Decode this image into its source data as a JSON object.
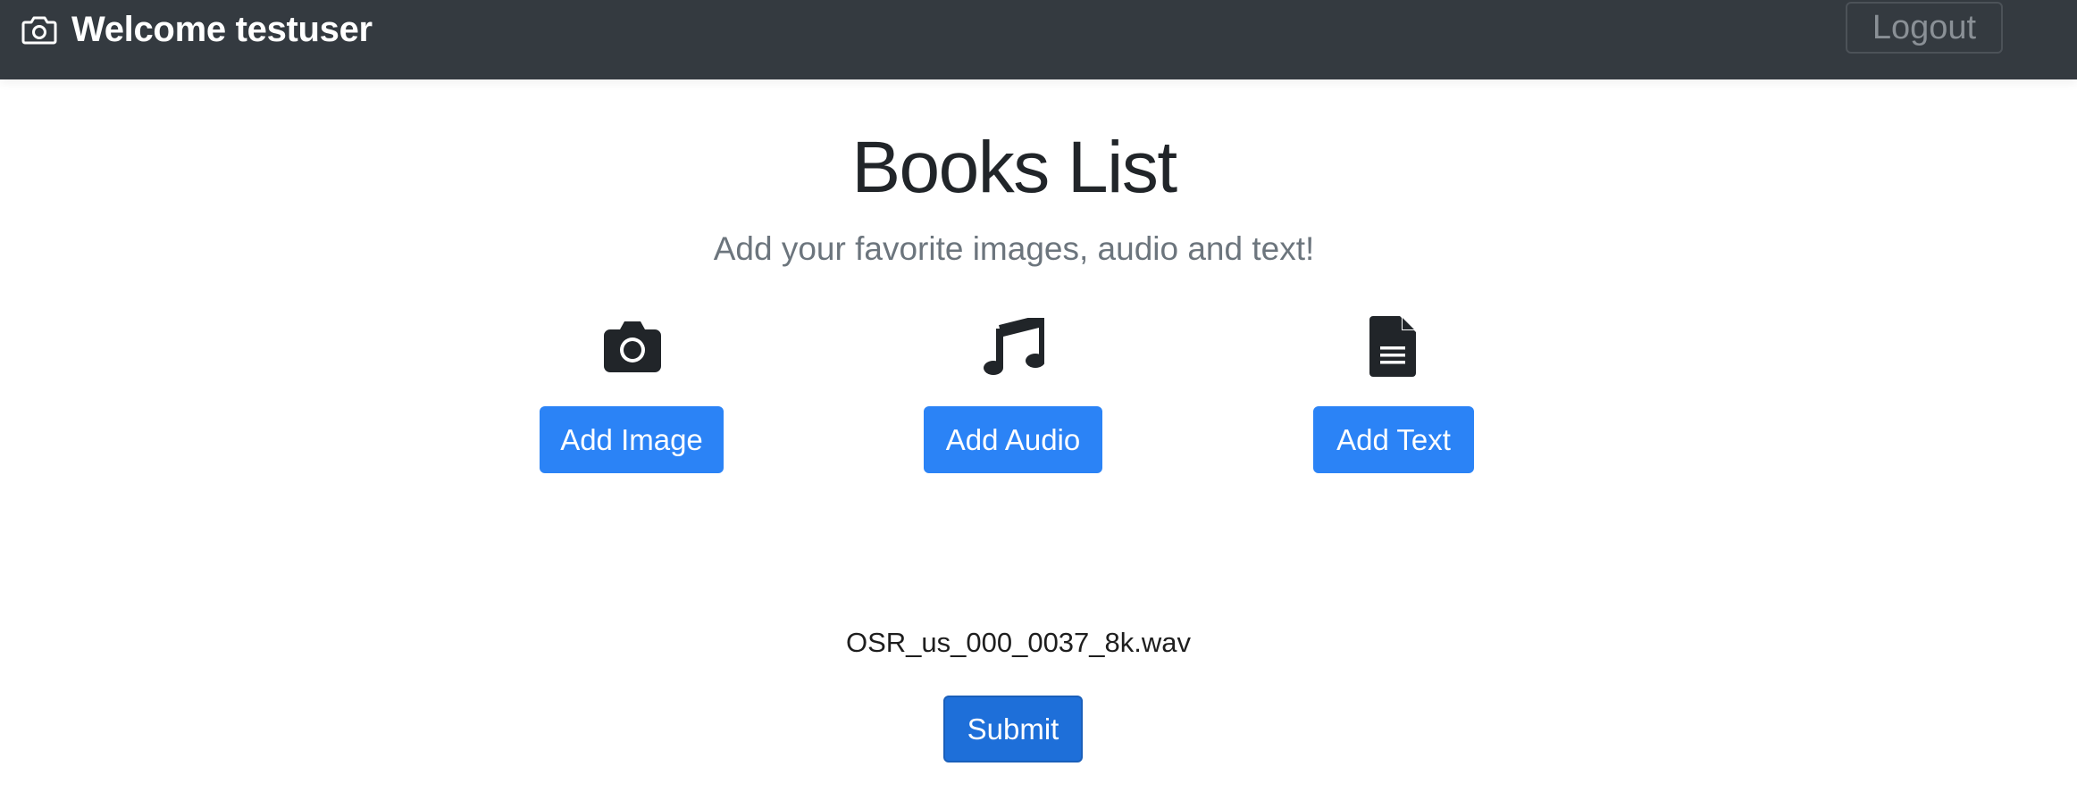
{
  "header": {
    "welcome_text": "Welcome testuser",
    "brand_icon": "camera-outline-icon",
    "logout_label": "Logout"
  },
  "main": {
    "title": "Books List",
    "subtitle": "Add your favorite images, audio and text!"
  },
  "actions": [
    {
      "icon": "camera-icon",
      "label": "Add Image"
    },
    {
      "icon": "music-note-icon",
      "label": "Add Audio"
    },
    {
      "icon": "file-text-icon",
      "label": "Add Text"
    }
  ],
  "upload": {
    "selected_file": "OSR_us_000_0037_8k.wav",
    "submit_label": "Submit"
  },
  "colors": {
    "navbar": "#343a40",
    "primary": "#2b83f6",
    "submit": "#1e6fd9",
    "muted_text": "#6c757d"
  }
}
